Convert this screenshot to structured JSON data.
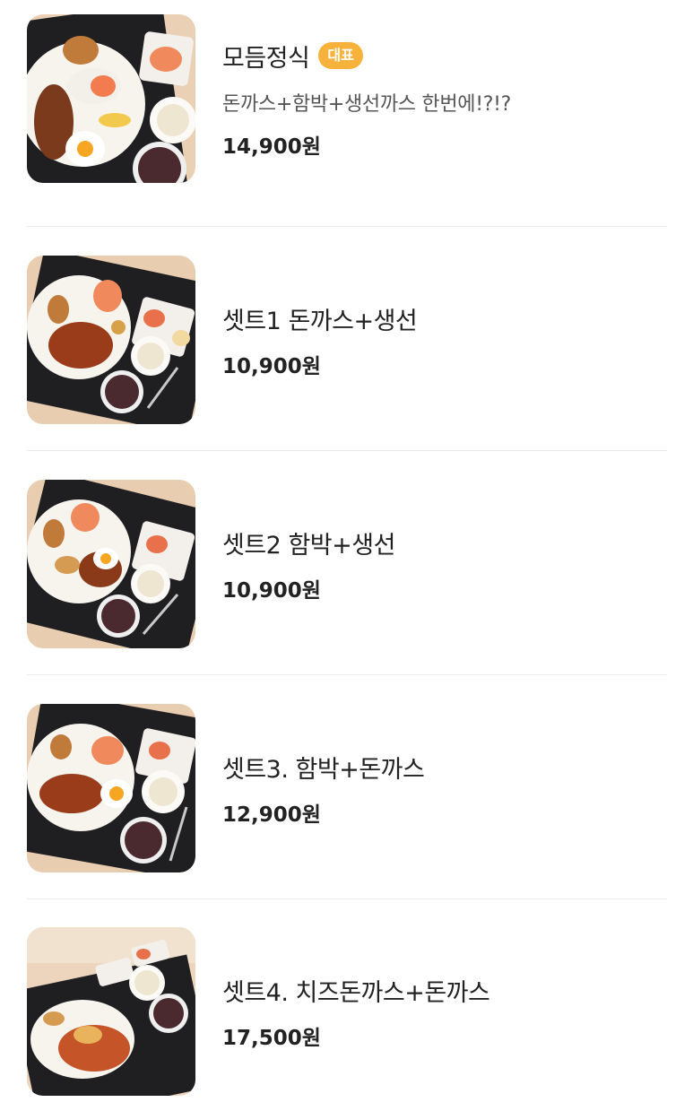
{
  "menu": {
    "items": [
      {
        "name": "모듬정식",
        "badge": "대표",
        "description": "돈까스+함박+생선까스 한번에!?!?",
        "price": "14,900원",
        "image": "food-photo"
      },
      {
        "name": "셋트1 돈까스+생선",
        "price": "10,900원",
        "image": "food-photo"
      },
      {
        "name": "셋트2 함박+생선",
        "price": "10,900원",
        "image": "food-photo"
      },
      {
        "name": "셋트3. 함박+돈까스",
        "price": "12,900원",
        "image": "food-photo"
      },
      {
        "name": "셋트4. 치즈돈까스+돈까스",
        "price": "17,500원",
        "image": "food-photo"
      }
    ]
  },
  "colors": {
    "badge": "#f7b23b",
    "divider": "#ececec",
    "tray": "#1f1f22",
    "table_wood": "#e9cdb0"
  }
}
